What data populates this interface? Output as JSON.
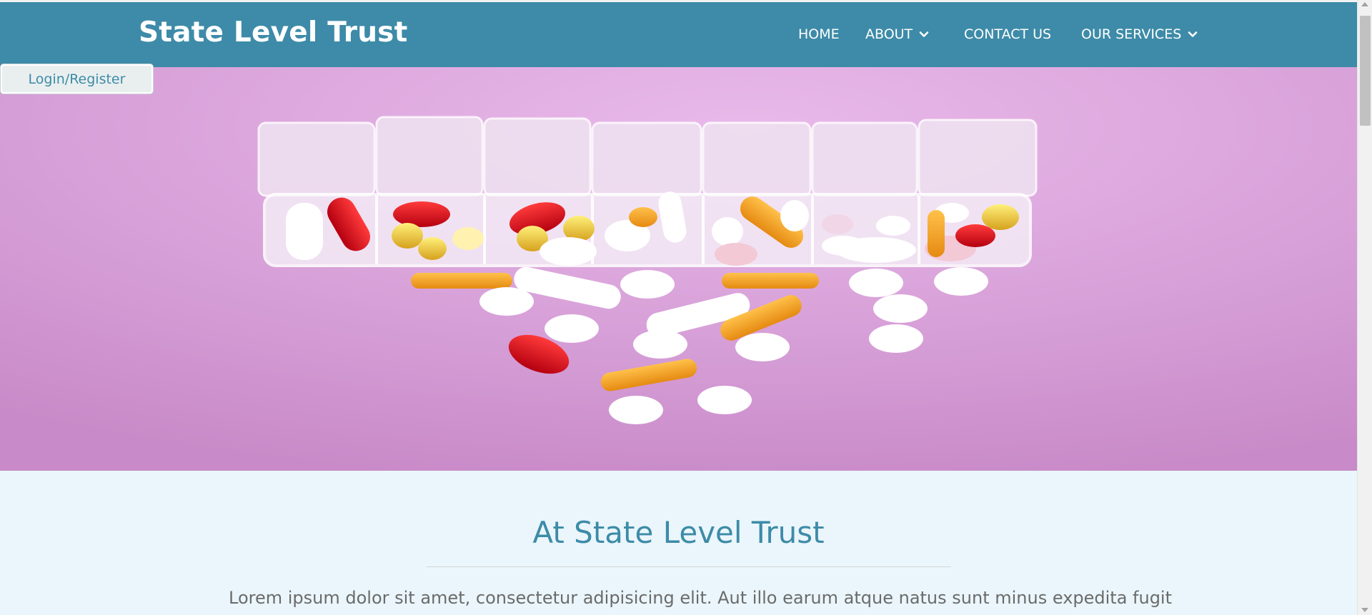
{
  "header": {
    "brand": "State Level Trust",
    "nav": [
      {
        "label": "HOME",
        "has_dropdown": false
      },
      {
        "label": "ABOUT",
        "has_dropdown": true
      },
      {
        "label": "CONTACT US",
        "has_dropdown": false
      },
      {
        "label": "OUR SERVICES",
        "has_dropdown": true
      }
    ]
  },
  "login": {
    "label": "Login/Register"
  },
  "hero": {
    "image": "pill-organizer-with-scattered-pills"
  },
  "intro": {
    "title": "At State Level Trust",
    "text": "Lorem ipsum dolor sit amet, consectetur adipisicing elit. Aut illo earum atque natus sunt minus expedita fugit a"
  },
  "colors": {
    "header": "#3d8ba8",
    "accent": "#3d8ba8",
    "intro_bg": "#eaf6fb",
    "hero_bg": "#d9a1d9"
  },
  "icons": {
    "dropdown": "chevron-down-icon"
  }
}
